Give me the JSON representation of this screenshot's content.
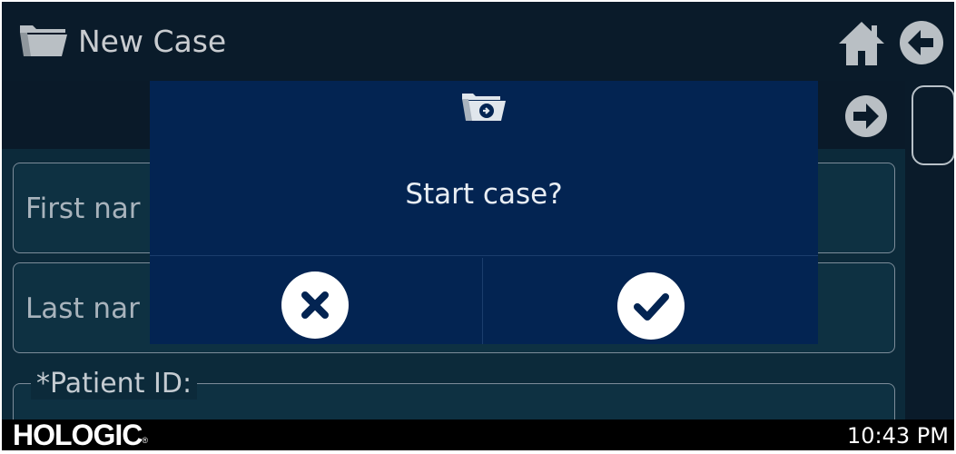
{
  "app": {
    "title": "New Case"
  },
  "form": {
    "first_name_label": "First nar",
    "last_name_label": "Last nar",
    "patient_id_label": "*Patient ID:"
  },
  "dialog": {
    "message": "Start case?"
  },
  "footer": {
    "brand": "HOLOGIC",
    "brand_mark": "®",
    "clock": "10:43 PM"
  },
  "icons": {
    "title": "folder-icon",
    "home": "home-icon",
    "back": "back-arrow-icon",
    "next": "next-arrow-icon",
    "dialog": "folder-start-icon",
    "cancel": "close-icon",
    "confirm": "checkmark-icon"
  },
  "colors": {
    "titlebar": "#0a1b2a",
    "dialog": "#032452",
    "icon_gray": "#b9bfc4",
    "text_light": "#e9eef4"
  }
}
